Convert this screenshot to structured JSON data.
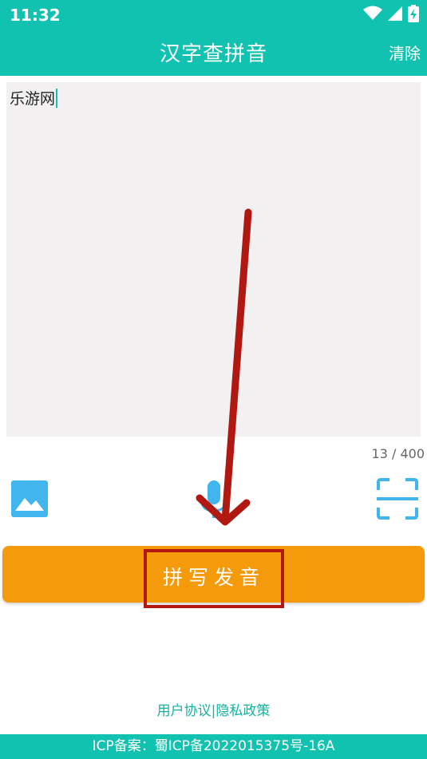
{
  "status_bar": {
    "time": "11:32",
    "icons": [
      "wifi-icon",
      "signal-icon",
      "battery-charging-icon"
    ]
  },
  "header": {
    "title": "汉字查拼音",
    "clear_label": "清除"
  },
  "input": {
    "text": "乐游网",
    "counter": "13 / 400"
  },
  "toolbar": {
    "icons": [
      "image-icon",
      "microphone-icon",
      "scan-icon"
    ]
  },
  "action": {
    "label": "拼写发音"
  },
  "links": {
    "user_agreement": "用户协议",
    "separator": "|",
    "privacy_policy": "隐私政策"
  },
  "footer": {
    "icp": "ICP备案：蜀ICP备2022015375号-16A"
  },
  "colors": {
    "primary": "#12c2b0",
    "button": "#f59b0b",
    "annotation": "#b21812",
    "icon": "#41b6ee"
  }
}
